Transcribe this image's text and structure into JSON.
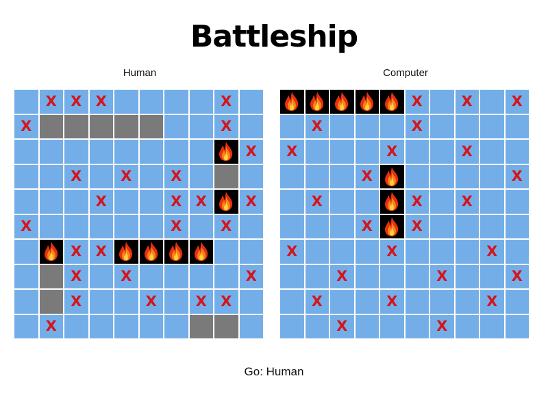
{
  "title": "Battleship",
  "status": "Go: Human",
  "legend": {
    "empty": "light-blue cell",
    "ship": "gray cell",
    "miss": "X",
    "hit": "fire-icon"
  },
  "colors": {
    "water": "#74aee8",
    "ship": "#7a7a7a",
    "hit_bg": "#000000",
    "miss": "#d6141b"
  },
  "boards": [
    {
      "label": "Human",
      "rows": [
        "_XXX____X_",
        "XSSSSS__X_",
        "________HX",
        "__X_X_X_S_",
        "___X__XXHX",
        "X_____X_X_",
        "_HXXHHHH__",
        "_SX_X____X",
        "_SX__X_XX_",
        "_X_____SS_"
      ]
    },
    {
      "label": "Computer",
      "rows": [
        "HHHHHX_X_X",
        "_X___X____",
        "X___X__X__",
        "___XH____X",
        "_X__HX_X__",
        "___XHX____",
        "X___X___X_",
        "__X___X__X",
        "_X__X___X_",
        "__X___X___"
      ]
    }
  ]
}
